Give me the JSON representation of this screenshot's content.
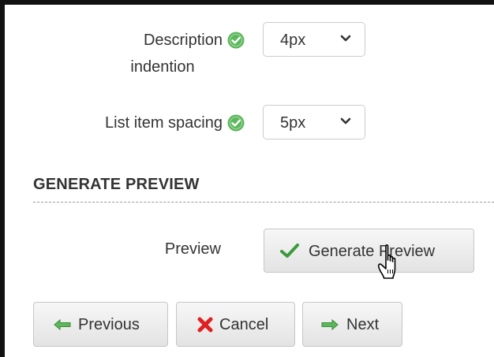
{
  "fields": {
    "description_indention": {
      "label_line1": "Description",
      "label_line2": "indention",
      "value": "4px"
    },
    "list_item_spacing": {
      "label": "List item spacing",
      "value": "5px"
    }
  },
  "section": {
    "title": "GENERATE PREVIEW"
  },
  "preview": {
    "label": "Preview",
    "button_label": "Generate Preview"
  },
  "nav": {
    "previous": "Previous",
    "cancel": "Cancel",
    "next": "Next"
  },
  "icons": {
    "valid": "check-circle",
    "dropdown": "chevron-down",
    "generate": "checkmark",
    "previous": "arrow-left",
    "cancel": "x-mark",
    "next": "arrow-right",
    "pointer": "hand-cursor"
  },
  "colors": {
    "valid_green": "#5cb85c",
    "check_green": "#3c9a3c",
    "cancel_red": "#e02020"
  }
}
